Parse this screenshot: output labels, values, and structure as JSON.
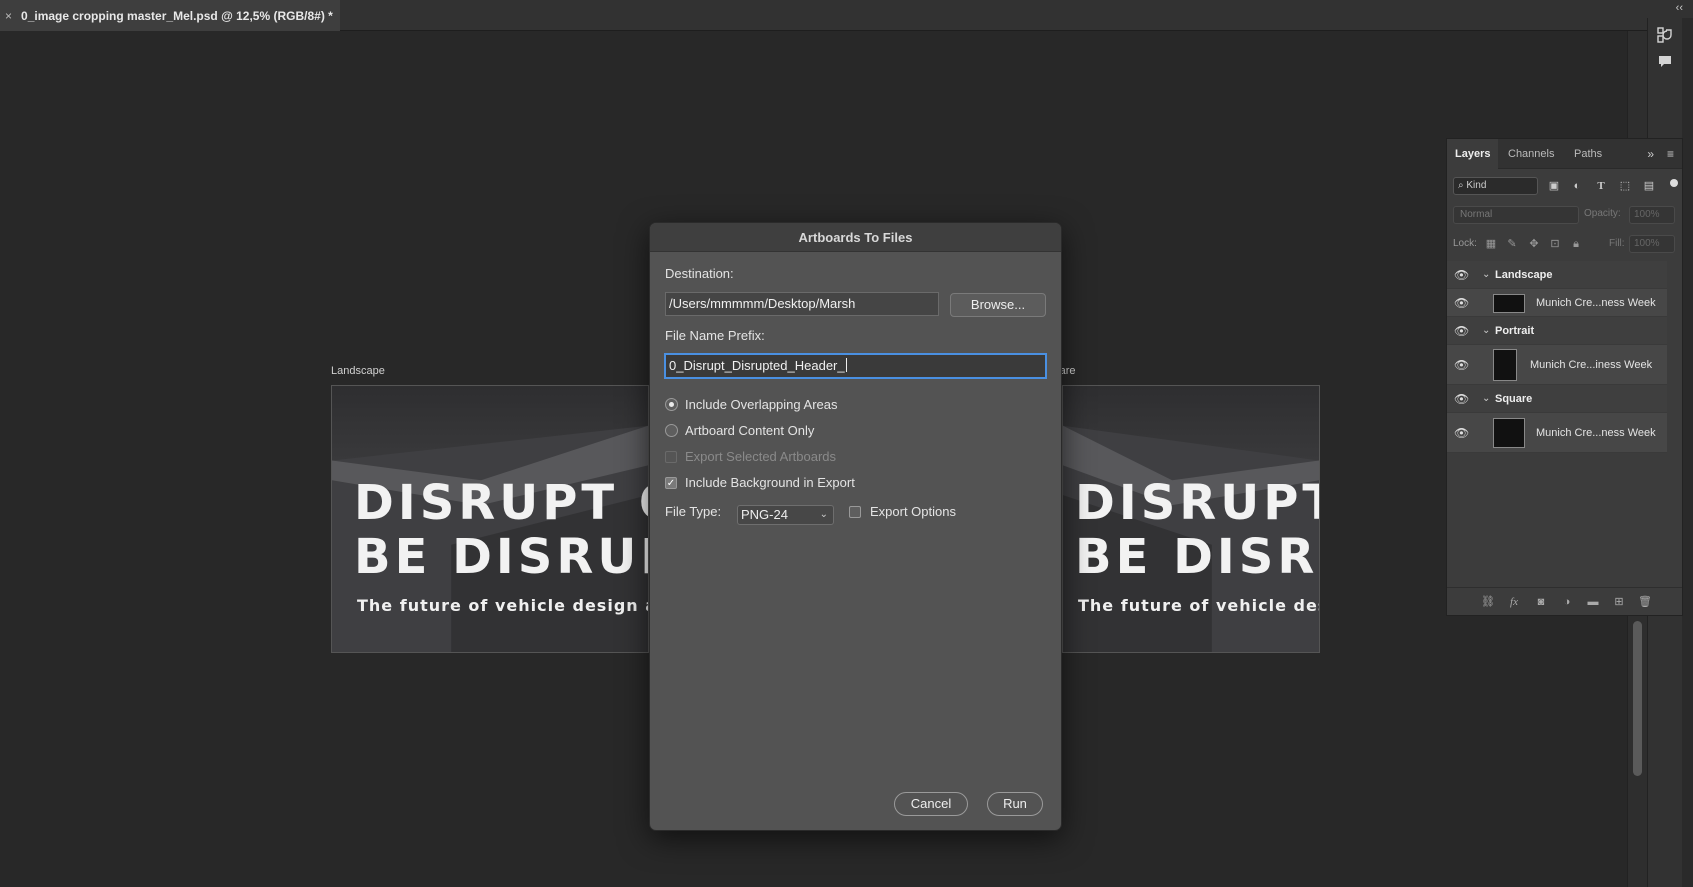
{
  "document": {
    "tab_close": "×",
    "tab_title": "0_image cropping master_Mel.psd @ 12,5% (RGB/8#) *",
    "collapse_glyph": "‹‹"
  },
  "canvas": {
    "artboards": [
      {
        "label": "Landscape",
        "headline_1": "DISRUPT OR",
        "headline_2": "BE DISRUPTED",
        "subline": "The future of vehicle design and production"
      },
      {
        "label": "Square",
        "headline_1": "DISRUPT",
        "headline_2": "BE DISRU",
        "subline": "The future of vehicle design"
      }
    ]
  },
  "layers_panel": {
    "tabs": [
      "Layers",
      "Channels",
      "Paths"
    ],
    "active_tab": "Layers",
    "more_glyph": "»",
    "menu_glyph": "≡",
    "filter": {
      "kind_label": "Kind"
    },
    "blend_mode": "Normal",
    "opacity_label": "Opacity:",
    "opacity_value": "100%",
    "lock_label": "Lock:",
    "fill_label": "Fill:",
    "fill_value": "100%",
    "groups": [
      {
        "name": "Landscape",
        "layer": "Munich Cre...ness Week"
      },
      {
        "name": "Portrait",
        "layer": "Munich Cre...iness Week"
      },
      {
        "name": "Square",
        "layer": "Munich Cre...ness Week"
      }
    ]
  },
  "dialog": {
    "title": "Artboards To Files",
    "destination_label": "Destination:",
    "destination_value": "/Users/mmmmm/Desktop/Marsh",
    "browse_label": "Browse...",
    "prefix_label": "File Name Prefix:",
    "prefix_value": "0_Disrupt_Disrupted_Header_",
    "option_overlapping": "Include Overlapping Areas",
    "option_content_only": "Artboard Content Only",
    "option_export_selected": "Export Selected Artboards",
    "option_include_background": "Include Background in Export",
    "file_type_label": "File Type:",
    "file_type_value": "PNG-24",
    "export_options_label": "Export Options",
    "cancel_label": "Cancel",
    "run_label": "Run",
    "check_glyph": "✓"
  }
}
